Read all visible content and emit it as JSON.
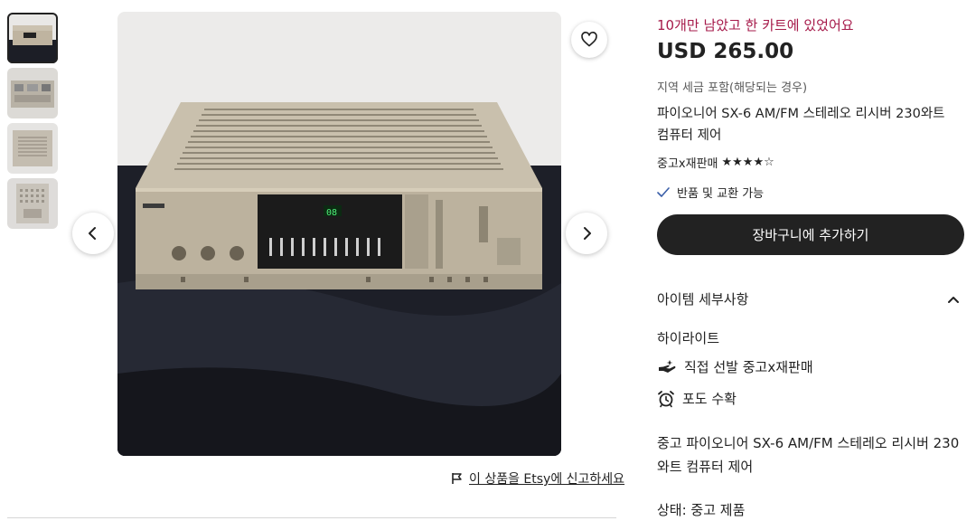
{
  "gallery": {
    "thumbnails": [
      {
        "alt": "front view",
        "active": true
      },
      {
        "alt": "rear view",
        "active": false
      },
      {
        "alt": "top view",
        "active": false
      },
      {
        "alt": "bottom view",
        "active": false
      }
    ],
    "prev_icon": "chevron-left-icon",
    "next_icon": "chevron-right-icon",
    "favorite_icon": "heart-icon"
  },
  "report": {
    "icon": "flag-icon",
    "link_text": "이 상품을 Etsy에 신고하세요"
  },
  "listing": {
    "stock_notice": "10개만 남았고 한 카트에 있었어요",
    "price": "USD 265.00",
    "tax_note": "지역 세금 포함(해당되는 경우)",
    "title": "파이오니어 SX-6 AM/FM 스테레오 리시버 230와트 컴퓨터 제어",
    "shop_name": "중고x재판매",
    "rating_stars": "★★★★☆",
    "returns_text": "반품 및 교환 가능",
    "add_to_cart": "장바구니에 추가하기",
    "details_heading": "아이템 세부사항",
    "highlights_heading": "하이라이트",
    "highlights": [
      {
        "icon": "hand-picked-icon",
        "text": "직접 선발 중고x재판매"
      },
      {
        "icon": "alarm-clock-icon",
        "text": "포도 수확"
      }
    ],
    "description": "중고 파이오니어 SX-6 AM/FM 스테레오 리시버 230와트 컴퓨터 제어",
    "condition": "상태: 중고 제품"
  },
  "colors": {
    "accent": "#a61a4a",
    "button_dark": "#222222",
    "check": "#3a5fa8"
  }
}
